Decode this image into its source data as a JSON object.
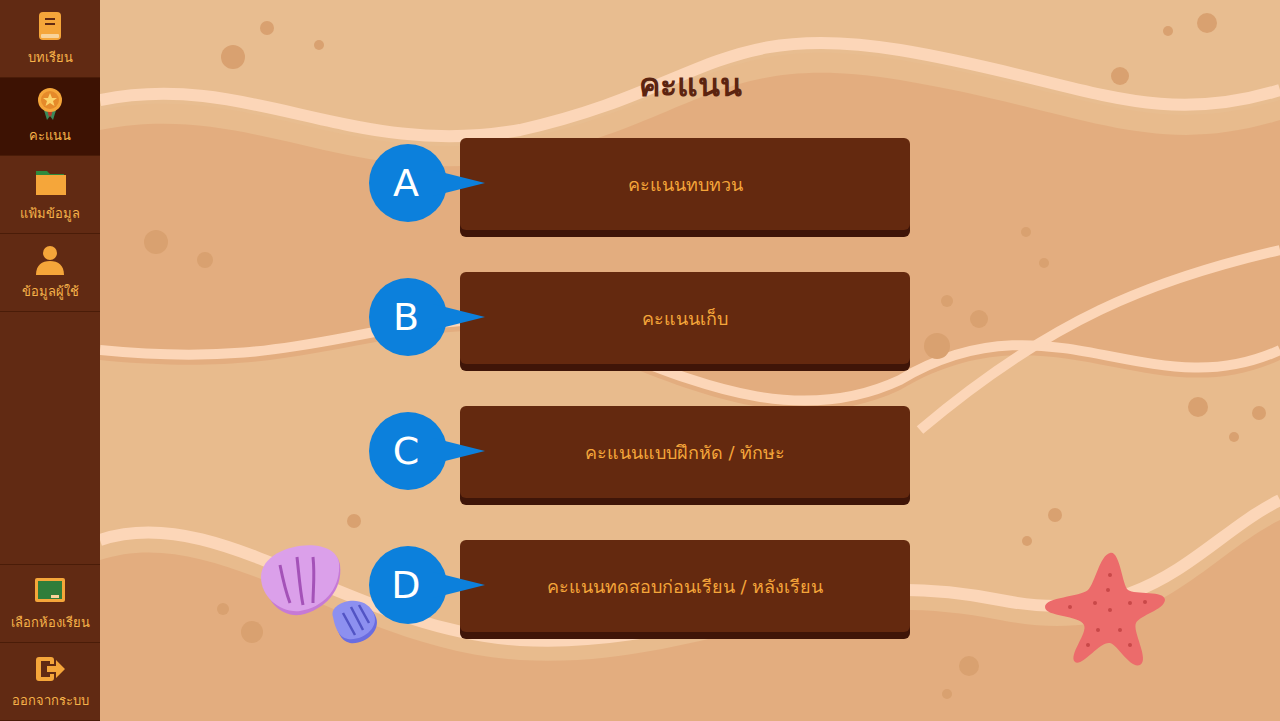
{
  "sidebar": {
    "items": [
      {
        "label": "บทเรียน",
        "selected": false
      },
      {
        "label": "คะแนน",
        "selected": true
      },
      {
        "label": "แฟ้มข้อมูล",
        "selected": false
      },
      {
        "label": "ข้อมูลผู้ใช้",
        "selected": false
      }
    ],
    "bottom_items": [
      {
        "label": "เลือกห้องเรียน",
        "selected": false
      },
      {
        "label": "ออกจากระบบ",
        "selected": false
      }
    ]
  },
  "page": {
    "title": "คะแนน"
  },
  "score_options": [
    {
      "badge": "A",
      "label": "คะแนนทบทวน"
    },
    {
      "badge": "B",
      "label": "คะแนนเก็บ"
    },
    {
      "badge": "C",
      "label": "คะแนนแบบฝึกหัด / ทักษะ"
    },
    {
      "badge": "D",
      "label": "คะแนนทดสอบก่อนเรียน / หลังเรียน"
    }
  ]
}
